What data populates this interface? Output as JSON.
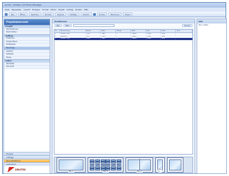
{
  "window": {
    "title": "Archiv - Fenster und Türen Manager"
  },
  "menu": [
    "Datei",
    "Bearbeiten",
    "Ansicht",
    "Einfügen",
    "Format",
    "Extras",
    "Projekt",
    "Auftrag",
    "Fenster",
    "Hilfe"
  ],
  "toolbar": [
    "Neu",
    "Öffnen",
    "Speichern",
    "Drucken",
    "Kopieren",
    "Einfügen",
    "Löschen",
    "Suchen",
    "Berechnen",
    "Export"
  ],
  "left_panel": {
    "title": "Projektübersicht",
    "sections": [
      {
        "label": "Projekt",
        "items": [
          "Alle Positionen",
          "Stammdaten"
        ]
      },
      {
        "label": "Auftrag",
        "items": [
          "Positionen",
          "Fenster/Türen",
          "Profile/Glas",
          "Beschläge",
          "Zubehör",
          "Rollladen",
          "Preise"
        ]
      },
      {
        "label": "Listen",
        "items": [
          "Stückliste",
          "Zuschnitt"
        ]
      }
    ],
    "bottom_items": [
      "Projekte",
      "Aufträge",
      "Neue Bestellung",
      "Lieferanten"
    ],
    "logo_text": "DRUTEX"
  },
  "center": {
    "header": "Positionen",
    "tools": [
      "Neu",
      "Filter"
    ],
    "tools_right": "Suchen",
    "grid": {
      "columns": [
        "Nr",
        "Bezeichnung",
        "Breite",
        "Höhe",
        "Menge",
        "Profil",
        "Glas",
        "Farbe",
        "Preis"
      ],
      "rows": [
        [
          "1",
          "Fenster 1-flg",
          "1230",
          "1480",
          "1",
          "Classic",
          "2-fach",
          "weiß",
          ""
        ],
        [
          "2",
          "Balkontür",
          "900",
          "2180",
          "1",
          "Classic",
          "2-fach",
          "weiß",
          ""
        ],
        [
          "3",
          "Fenster 2-flg",
          "1600",
          "1480",
          "2",
          "Classic",
          "2-fach",
          "weiß",
          ""
        ]
      ],
      "selected_row": 2
    },
    "previews": [
      "Pos. 1",
      "Pos. 2",
      "Pos. 3",
      "Pos. 4"
    ]
  },
  "right_panel": {
    "header": "Info",
    "items": [
      "Pos. 3 aktiv"
    ]
  },
  "colors": {
    "accent": "#3a6cb4",
    "selection": "#1f2f86",
    "logo": "#d4261f"
  }
}
